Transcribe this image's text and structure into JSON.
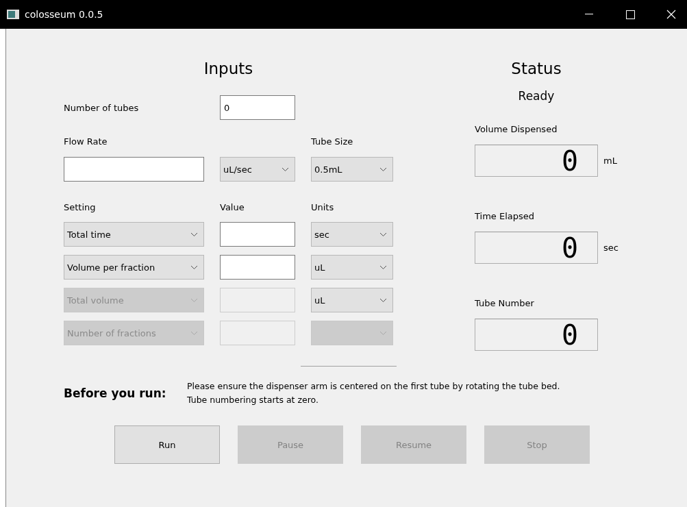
{
  "window": {
    "title": "colosseum 0.0.5"
  },
  "inputs": {
    "heading": "Inputs",
    "number_of_tubes": {
      "label": "Number of tubes",
      "value": "0"
    },
    "flow_rate": {
      "label": "Flow Rate",
      "unit": "uL/sec"
    },
    "tube_size": {
      "label": "Tube Size",
      "value": "0.5mL"
    },
    "columns": [
      "Setting",
      "Value",
      "Units"
    ],
    "rows": [
      {
        "setting": "Total time",
        "setting_disabled": false,
        "value_disabled": false,
        "units": "sec",
        "units_disabled": false
      },
      {
        "setting": "Volume per fraction",
        "setting_disabled": false,
        "value_disabled": false,
        "units": "uL",
        "units_disabled": false
      },
      {
        "setting": "Total volume",
        "setting_disabled": true,
        "value_disabled": true,
        "units": "uL",
        "units_disabled": false
      },
      {
        "setting": "Number of fractions",
        "setting_disabled": true,
        "value_disabled": true,
        "units_disabled": true
      }
    ]
  },
  "status": {
    "heading": "Status",
    "state": "Ready",
    "readouts": [
      {
        "label": "Volume Dispensed",
        "value": "0",
        "unit": "mL"
      },
      {
        "label": "Time Elapsed",
        "value": "0",
        "unit": "sec"
      },
      {
        "label": "Tube Number",
        "value": "0"
      }
    ]
  },
  "notice": {
    "heading": "Before you run:",
    "lines": [
      "Please ensure the dispenser arm is centered on the first tube by rotating the tube bed.",
      "Tube numbering starts at zero."
    ]
  },
  "buttons": [
    {
      "label": "Run",
      "disabled": false
    },
    {
      "label": "Pause",
      "disabled": true
    },
    {
      "label": "Resume",
      "disabled": true
    },
    {
      "label": "Stop",
      "disabled": true
    }
  ]
}
